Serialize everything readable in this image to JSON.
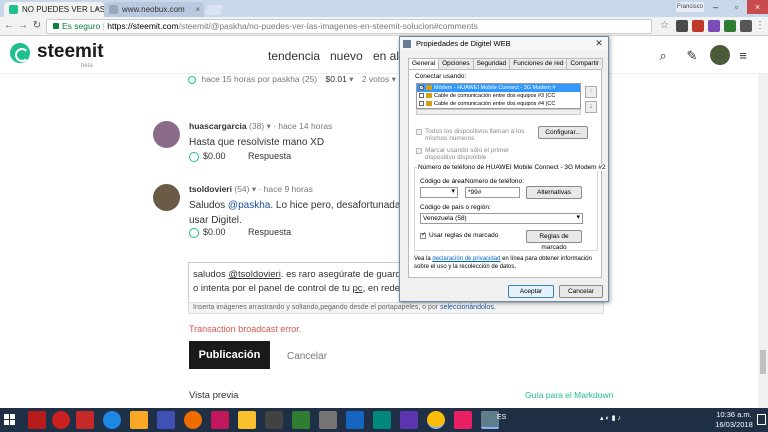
{
  "browser": {
    "tabs": [
      {
        "title": "NO PUEDES VER LAS IM..."
      },
      {
        "title": "www.neobux.com"
      }
    ],
    "window_user": "Francisco",
    "url_secure_label": "Es seguro",
    "url_host": "https://steemit.com",
    "url_path": "/steemit/@paskha/no-puedes-ver-las-imagenes-en-steemit-solucion#comments"
  },
  "site": {
    "logo": "steemit",
    "beta": "beta",
    "nav": [
      "tendencia",
      "nuevo",
      "en alza"
    ]
  },
  "post_meta": {
    "time": "hace 15 horas por paskha (25)",
    "payout": "$0.01",
    "votes": "2 votos"
  },
  "comments": [
    {
      "user": "huascargarcia",
      "rep": "(38)",
      "time": "hace 14 horas",
      "body": [
        "Hasta que resolviste mano XD"
      ],
      "payout": "$0.00",
      "reply": "Respuesta"
    },
    {
      "user": "tsoldovieri",
      "rep": "(54)",
      "time": "hace 9 horas",
      "body_prefix": "Saludos ",
      "mention": "@paskha",
      "body_suffix": ". Lo hice pero, desafortunadamente, n",
      "body_line2": "usar Digitel.",
      "payout": "$0.00",
      "reply": "Respuesta"
    }
  ],
  "reply_editor": {
    "line1_prefix": "saludos ",
    "line1_mention": "@tsoldovieri",
    "line1_suffix": ". es raro asegúrate de guardar bier",
    "line2_prefix": "o intenta por el panel de control de tu ",
    "line2_pc": "pc",
    "line2_suffix": ", en redes de In",
    "drop_hint_prefix": "Inserta imágenes arrastrando y soltando,pegando desde el portapapeles, o por ",
    "drop_hint_link": "seleccionándolos.",
    "error": "Transaction broadcast error.",
    "publish": "Publicación",
    "cancel": "Cancelar",
    "preview": "Vista previa",
    "markdown_guide": "Guía para el Markdown"
  },
  "dialog": {
    "title": "Propiedades de Digitel WEB",
    "tabs": [
      "General",
      "Opciones",
      "Seguridad",
      "Funciones de red",
      "Compartir"
    ],
    "connect_using": "Conectar usando:",
    "devices": [
      {
        "label": "Módem - HUAWEI Mobile Connect - 3G Modem #",
        "checked": true,
        "selected": true
      },
      {
        "label": "Cable de comunicación entre dos equipos #3 (CC",
        "checked": false,
        "selected": false
      },
      {
        "label": "Cable de comunicación entre dos equipos #4 (CC",
        "checked": false,
        "selected": false
      }
    ],
    "all_devices_same": "Todos los dispositivos llaman a los mismos números",
    "configure": "Configurar...",
    "dial_first_only": "Marcar usando sólo el primer dispositivo disponible",
    "phone_group_title": "Número de teléfono de HUAWEI Mobile Connect - 3G Modem #2",
    "area_code_label": "Código de área:",
    "area_code": "",
    "phone_label": "Número de teléfono:",
    "phone": "*99#",
    "alternatives": "Alternativas",
    "country_label": "Código de país o región:",
    "country": "Venezuela (58)",
    "use_dialing_rules": "Usar reglas de marcado",
    "dialing_rules_btn": "Reglas de marcado",
    "privacy_prefix": "Vea la ",
    "privacy_link": "declaración de privacidad",
    "privacy_suffix": " en línea para obtener información sobre el uso y la recolección de datos.",
    "ok": "Aceptar",
    "cancel": "Cancelar"
  },
  "taskbar": {
    "lang": "ES",
    "time": "10:36 a.m.",
    "date": "16/03/2018"
  }
}
